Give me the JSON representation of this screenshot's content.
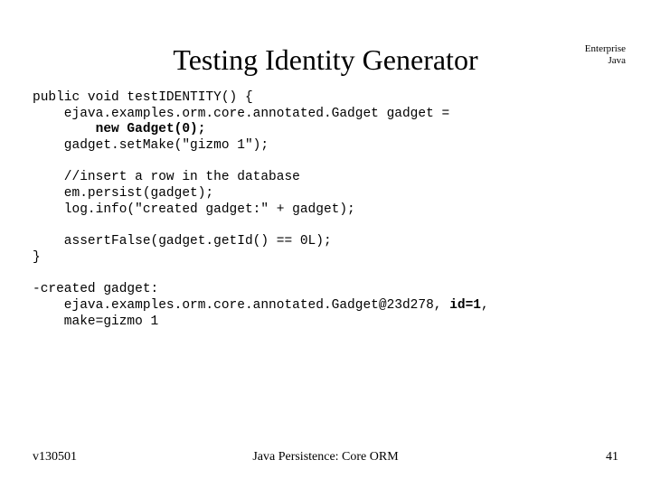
{
  "header": {
    "title": "Testing Identity Generator",
    "top_right_line1": "Enterprise",
    "top_right_line2": "Java"
  },
  "code": {
    "l1": "public void testIDENTITY() {",
    "l2": "    ejava.examples.orm.core.annotated.Gadget gadget =",
    "l3a": "        ",
    "l3b": "new Gadget(0);",
    "l4": "    gadget.setMake(\"gizmo 1\");",
    "l5": "",
    "l6": "    //insert a row in the database",
    "l7": "    em.persist(gadget);",
    "l8": "    log.info(\"created gadget:\" + gadget);",
    "l9": "",
    "l10": "    assertFalse(gadget.getId() == 0L);",
    "l11": "}",
    "l12": "",
    "l13": "-created gadget:",
    "l14a": "    ejava.examples.orm.core.annotated.Gadget@23d278, ",
    "l14b": "id=1",
    "l14c": ",",
    "l15": "    make=gizmo 1"
  },
  "footer": {
    "left": "v130501",
    "center": "Java Persistence: Core ORM",
    "right": "41"
  }
}
